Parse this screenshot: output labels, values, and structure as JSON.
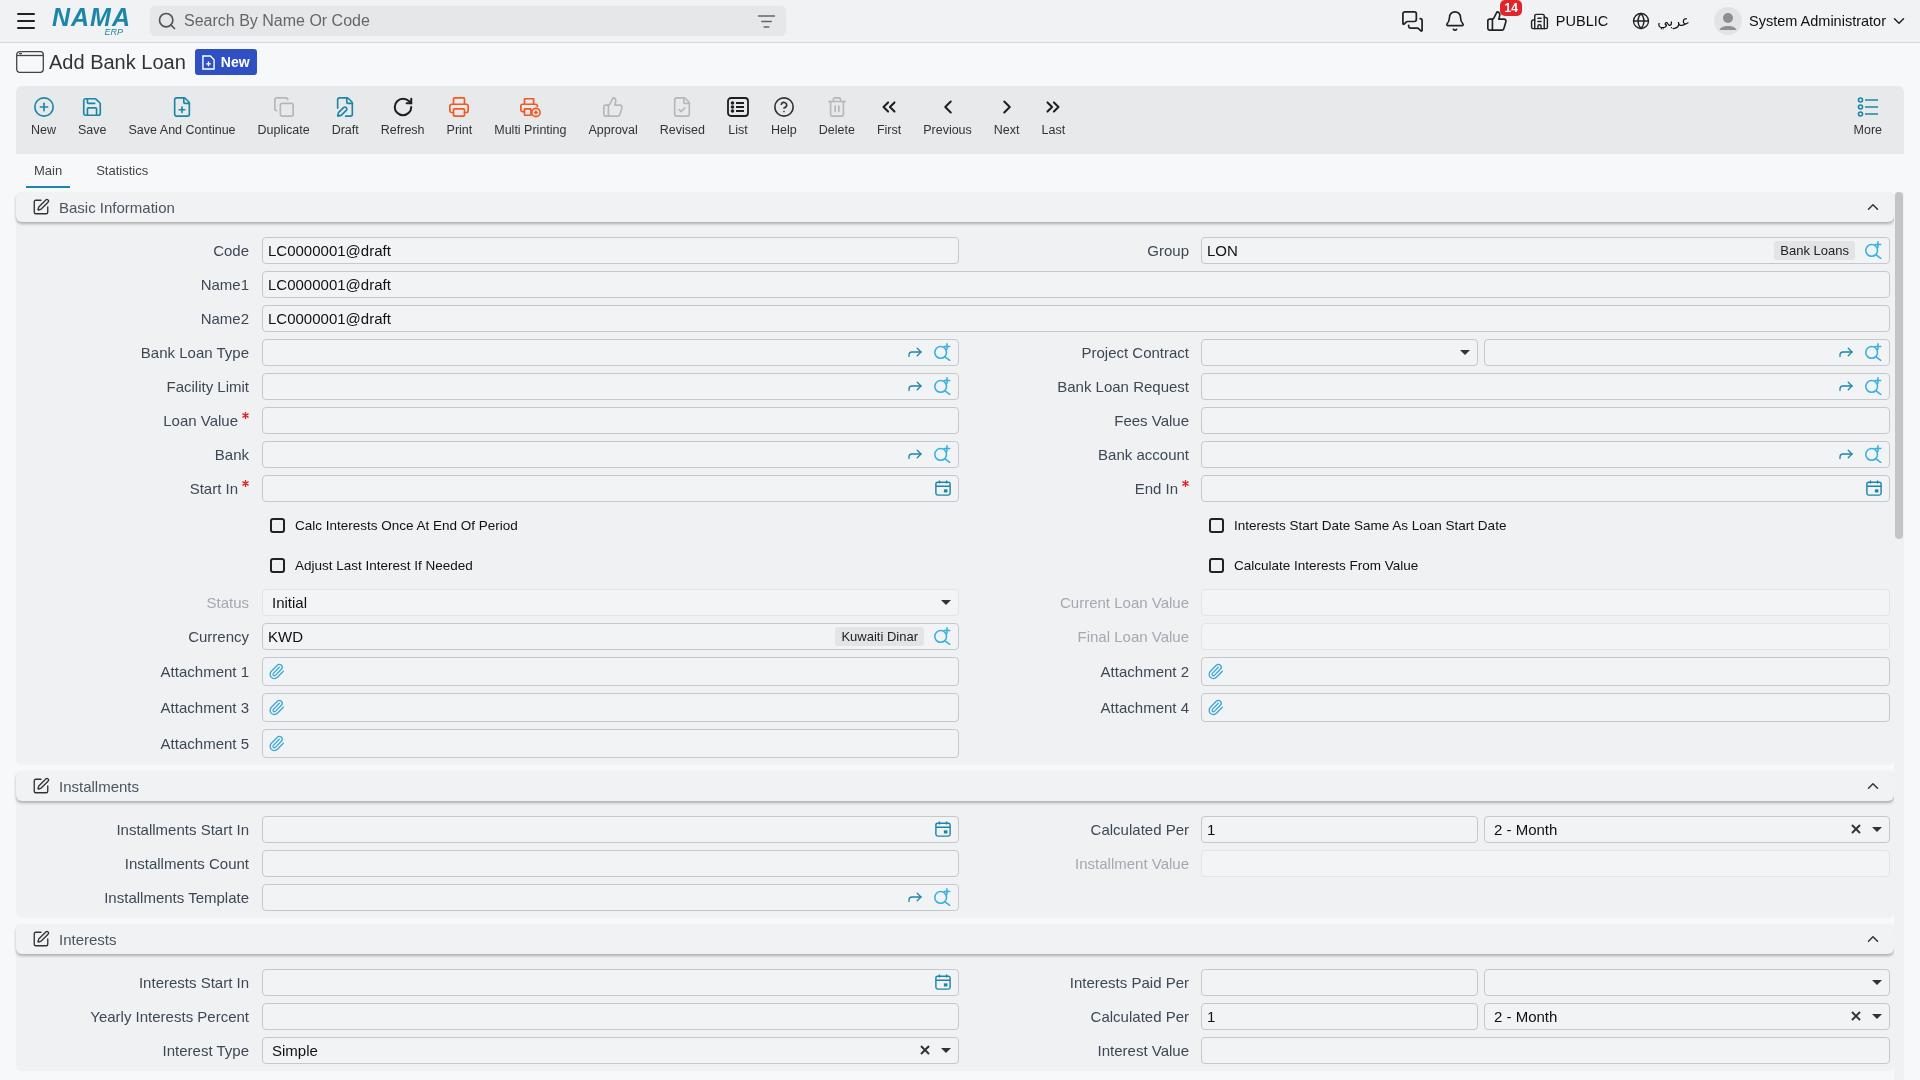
{
  "header": {
    "logo": {
      "name": "NAMA",
      "sub": "ERP"
    },
    "search": {
      "placeholder": "Search By Name Or Code"
    },
    "approvals_badge": "14",
    "branch": "PUBLIC",
    "language": "عربي",
    "user": "System Administrator"
  },
  "page": {
    "title": "Add Bank Loan",
    "badge": "New"
  },
  "toolbar": [
    {
      "kind": "new",
      "label": "New",
      "disabled": false
    },
    {
      "kind": "save",
      "label": "Save",
      "disabled": false
    },
    {
      "kind": "save-continue",
      "label": "Save And Continue",
      "disabled": false
    },
    {
      "kind": "duplicate",
      "label": "Duplicate",
      "disabled": true
    },
    {
      "kind": "draft",
      "label": "Draft",
      "disabled": false
    },
    {
      "kind": "refresh",
      "label": "Refresh",
      "disabled": false
    },
    {
      "kind": "print",
      "label": "Print",
      "disabled": false
    },
    {
      "kind": "multi-print",
      "label": "Multi Printing",
      "disabled": false
    },
    {
      "kind": "approval",
      "label": "Approval",
      "disabled": true
    },
    {
      "kind": "revised",
      "label": "Revised",
      "disabled": true
    },
    {
      "kind": "list",
      "label": "List",
      "disabled": false
    },
    {
      "kind": "help",
      "label": "Help",
      "disabled": false
    },
    {
      "kind": "delete",
      "label": "Delete",
      "disabled": true
    },
    {
      "kind": "first",
      "label": "First",
      "disabled": false
    },
    {
      "kind": "previous",
      "label": "Previous",
      "disabled": false
    },
    {
      "kind": "next",
      "label": "Next",
      "disabled": false
    },
    {
      "kind": "last",
      "label": "Last",
      "disabled": false
    }
  ],
  "toolbar_more": {
    "label": "More"
  },
  "tabs": [
    {
      "label": "Main",
      "selected": true
    },
    {
      "label": "Statistics",
      "selected": false
    }
  ],
  "sections": [
    {
      "title": "Basic Information",
      "expanded": true,
      "rows": [
        {
          "kind": "split",
          "fields": [
            {
              "kind": "input",
              "label": "Code",
              "required": false,
              "disabled": false,
              "controls": [
                {
                  "kind": "text",
                  "value": "LC0000001@draft"
                }
              ]
            },
            {
              "kind": "input",
              "label": "Group",
              "required": false,
              "disabled": false,
              "controls": [
                {
                  "kind": "coded",
                  "value": "LON",
                  "tag": "Bank Loans"
                }
              ]
            }
          ]
        },
        {
          "kind": "wide",
          "fields": [
            {
              "kind": "input",
              "label": "Name1",
              "required": false,
              "disabled": false,
              "controls": [
                {
                  "kind": "text",
                  "value": "LC0000001@draft"
                }
              ]
            }
          ]
        },
        {
          "kind": "wide",
          "fields": [
            {
              "kind": "input",
              "label": "Name2",
              "required": false,
              "disabled": false,
              "controls": [
                {
                  "kind": "text",
                  "value": "LC0000001@draft"
                }
              ]
            }
          ]
        },
        {
          "kind": "split",
          "fields": [
            {
              "kind": "input",
              "label": "Bank Loan Type",
              "required": false,
              "disabled": false,
              "controls": [
                {
                  "kind": "lookup"
                }
              ]
            },
            {
              "kind": "input",
              "label": "Project Contract",
              "required": false,
              "disabled": false,
              "controls": [
                {
                  "kind": "select",
                  "clearable": false
                },
                {
                  "kind": "lookup"
                }
              ]
            }
          ]
        },
        {
          "kind": "split",
          "fields": [
            {
              "kind": "input",
              "label": "Facility Limit",
              "required": false,
              "disabled": false,
              "controls": [
                {
                  "kind": "lookup"
                }
              ]
            },
            {
              "kind": "input",
              "label": "Bank Loan Request",
              "required": false,
              "disabled": false,
              "controls": [
                {
                  "kind": "lookup"
                }
              ]
            }
          ]
        },
        {
          "kind": "split",
          "fields": [
            {
              "kind": "input",
              "label": "Loan Value",
              "required": true,
              "disabled": false,
              "controls": [
                {
                  "kind": "text"
                }
              ]
            },
            {
              "kind": "input",
              "label": "Fees Value",
              "required": false,
              "disabled": false,
              "controls": [
                {
                  "kind": "text"
                }
              ]
            }
          ]
        },
        {
          "kind": "split",
          "fields": [
            {
              "kind": "input",
              "label": "Bank",
              "required": false,
              "disabled": false,
              "controls": [
                {
                  "kind": "lookup"
                }
              ]
            },
            {
              "kind": "input",
              "label": "Bank account",
              "required": false,
              "disabled": false,
              "controls": [
                {
                  "kind": "lookup"
                }
              ]
            }
          ]
        },
        {
          "kind": "split",
          "fields": [
            {
              "kind": "input",
              "label": "Start In",
              "required": true,
              "disabled": false,
              "controls": [
                {
                  "kind": "date"
                }
              ]
            },
            {
              "kind": "input",
              "label": "End In",
              "required": true,
              "disabled": false,
              "controls": [
                {
                  "kind": "date"
                }
              ]
            }
          ]
        },
        {
          "kind": "split",
          "fields": [
            {
              "kind": "checkbox",
              "label": "Calc Interests Once At End Of Period",
              "checked": false
            },
            {
              "kind": "checkbox",
              "label": "Interests Start Date Same As Loan Start Date",
              "checked": false
            }
          ]
        },
        {
          "kind": "split",
          "fields": [
            {
              "kind": "checkbox",
              "label": "Adjust Last Interest If Needed",
              "checked": false
            },
            {
              "kind": "checkbox",
              "label": "Calculate Interests From Value",
              "checked": false
            }
          ]
        },
        {
          "kind": "split",
          "fields": [
            {
              "kind": "input",
              "label": "Status",
              "required": false,
              "disabled": true,
              "controls": [
                {
                  "kind": "select",
                  "value": "Initial",
                  "clearable": false
                }
              ]
            },
            {
              "kind": "input",
              "label": "Current Loan Value",
              "required": false,
              "disabled": true,
              "controls": [
                {
                  "kind": "text"
                }
              ]
            }
          ]
        },
        {
          "kind": "split",
          "fields": [
            {
              "kind": "input",
              "label": "Currency",
              "required": false,
              "disabled": false,
              "controls": [
                {
                  "kind": "coded",
                  "value": "KWD",
                  "tag": "Kuwaiti Dinar"
                }
              ]
            },
            {
              "kind": "input",
              "label": "Final Loan Value",
              "required": false,
              "disabled": true,
              "controls": [
                {
                  "kind": "text"
                }
              ]
            }
          ]
        },
        {
          "kind": "split",
          "fields": [
            {
              "kind": "input",
              "label": "Attachment 1",
              "required": false,
              "disabled": false,
              "controls": [
                {
                  "kind": "attachment"
                }
              ]
            },
            {
              "kind": "input",
              "label": "Attachment 2",
              "required": false,
              "disabled": false,
              "controls": [
                {
                  "kind": "attachment"
                }
              ]
            }
          ]
        },
        {
          "kind": "split",
          "fields": [
            {
              "kind": "input",
              "label": "Attachment 3",
              "required": false,
              "disabled": false,
              "controls": [
                {
                  "kind": "attachment"
                }
              ]
            },
            {
              "kind": "input",
              "label": "Attachment 4",
              "required": false,
              "disabled": false,
              "controls": [
                {
                  "kind": "attachment"
                }
              ]
            }
          ]
        },
        {
          "kind": "split",
          "fields": [
            {
              "kind": "input",
              "label": "Attachment 5",
              "required": false,
              "disabled": false,
              "controls": [
                {
                  "kind": "attachment"
                }
              ]
            }
          ]
        }
      ]
    },
    {
      "title": "Installments",
      "expanded": true,
      "rows": [
        {
          "kind": "split",
          "fields": [
            {
              "kind": "input",
              "label": "Installments Start In",
              "required": false,
              "disabled": false,
              "controls": [
                {
                  "kind": "date"
                }
              ]
            },
            {
              "kind": "input",
              "label": "Calculated Per",
              "required": false,
              "disabled": false,
              "controls": [
                {
                  "kind": "text",
                  "value": "1"
                },
                {
                  "kind": "select",
                  "value": "2 - Month",
                  "clearable": true
                }
              ]
            }
          ]
        },
        {
          "kind": "split",
          "fields": [
            {
              "kind": "input",
              "label": "Installments Count",
              "required": false,
              "disabled": false,
              "controls": [
                {
                  "kind": "text"
                }
              ]
            },
            {
              "kind": "input",
              "label": "Installment Value",
              "required": false,
              "disabled": true,
              "controls": [
                {
                  "kind": "text"
                }
              ]
            }
          ]
        },
        {
          "kind": "split",
          "fields": [
            {
              "kind": "input",
              "label": "Installments Template",
              "required": false,
              "disabled": false,
              "controls": [
                {
                  "kind": "lookup"
                }
              ]
            }
          ]
        }
      ]
    },
    {
      "title": "Interests",
      "expanded": true,
      "rows": [
        {
          "kind": "split",
          "fields": [
            {
              "kind": "input",
              "label": "Interests Start In",
              "required": false,
              "disabled": false,
              "controls": [
                {
                  "kind": "date"
                }
              ]
            },
            {
              "kind": "input",
              "label": "Interests Paid Per",
              "required": false,
              "disabled": false,
              "controls": [
                {
                  "kind": "text"
                },
                {
                  "kind": "select",
                  "clearable": false
                }
              ]
            }
          ]
        },
        {
          "kind": "split",
          "fields": [
            {
              "kind": "input",
              "label": "Yearly Interests Percent",
              "required": false,
              "disabled": false,
              "controls": [
                {
                  "kind": "text"
                }
              ]
            },
            {
              "kind": "input",
              "label": "Calculated Per",
              "required": false,
              "disabled": false,
              "controls": [
                {
                  "kind": "text",
                  "value": "1"
                },
                {
                  "kind": "select",
                  "value": "2 - Month",
                  "clearable": true
                }
              ]
            }
          ]
        },
        {
          "kind": "split",
          "fields": [
            {
              "kind": "input",
              "label": "Interest Type",
              "required": false,
              "disabled": false,
              "controls": [
                {
                  "kind": "select",
                  "value": "Simple",
                  "clearable": true
                }
              ]
            },
            {
              "kind": "input",
              "label": "Interest Value",
              "required": false,
              "disabled": false,
              "controls": [
                {
                  "kind": "text"
                }
              ]
            }
          ]
        }
      ]
    }
  ]
}
